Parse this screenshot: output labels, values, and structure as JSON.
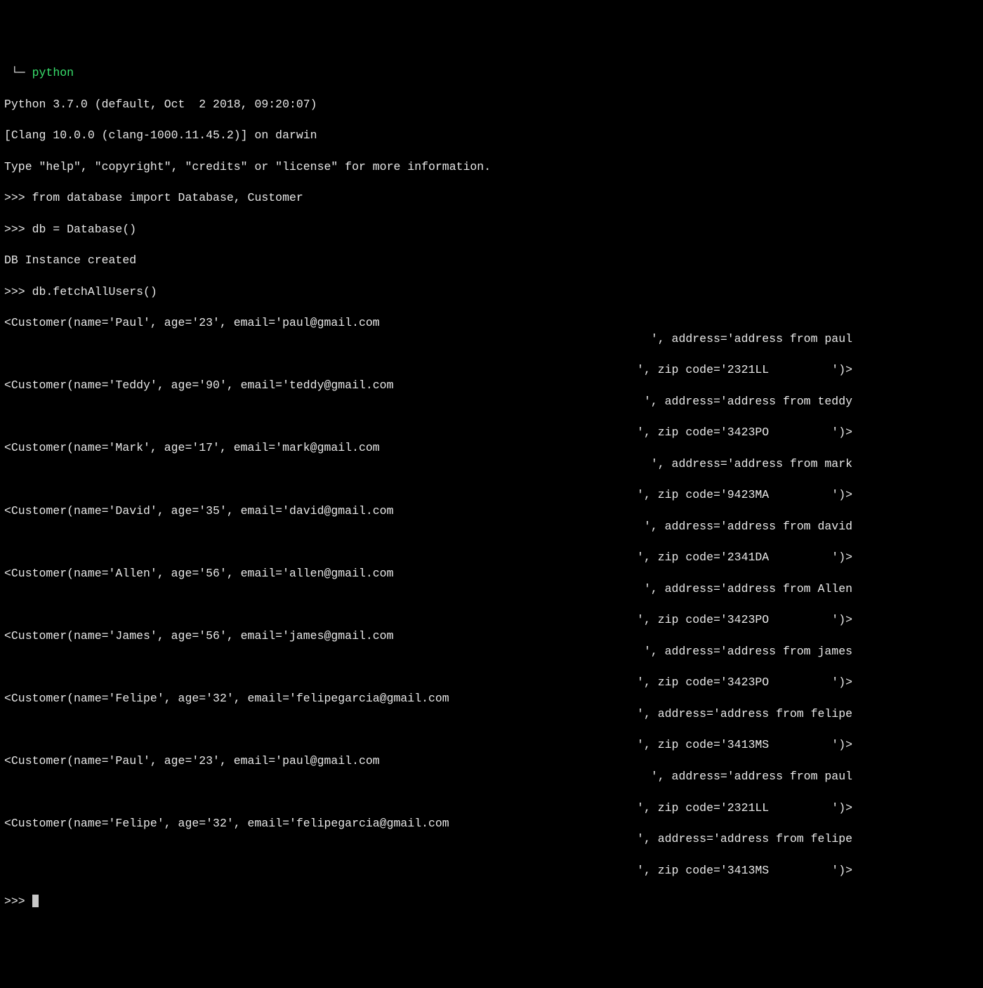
{
  "title_prefix": " └─ ",
  "title_cmd": "python",
  "lines": {
    "version": "Python 3.7.0 (default, Oct  2 2018, 09:20:07)",
    "clang": "[Clang 10.0.0 (clang-1000.11.45.2)] on darwin",
    "help": "Type \"help\", \"copyright\", \"credits\" or \"license\" for more information.",
    "import": ">>> from database import Database, Customer",
    "dbinit": ">>> db = Database()",
    "created": "DB Instance created",
    "fetch": ">>> db.fetchAllUsers()"
  },
  "customers": [
    {
      "name": "Paul",
      "age": "23",
      "email": "paul@gmail.com",
      "address": "address from paul",
      "zip": "2321LL"
    },
    {
      "name": "Teddy",
      "age": "90",
      "email": "teddy@gmail.com",
      "address": "address from teddy",
      "zip": "3423PO"
    },
    {
      "name": "Mark",
      "age": "17",
      "email": "mark@gmail.com",
      "address": "address from mark",
      "zip": "9423MA"
    },
    {
      "name": "David",
      "age": "35",
      "email": "david@gmail.com",
      "address": "address from david",
      "zip": "2341DA"
    },
    {
      "name": "Allen",
      "age": "56",
      "email": "allen@gmail.com",
      "address": "address from Allen",
      "zip": "3423PO"
    },
    {
      "name": "James",
      "age": "56",
      "email": "james@gmail.com",
      "address": "address from james",
      "zip": "3423PO"
    },
    {
      "name": "Felipe",
      "age": "32",
      "email": "felipegarcia@gmail.com",
      "address": "address from felipe",
      "zip": "3413MS"
    },
    {
      "name": "Paul",
      "age": "23",
      "email": "paul@gmail.com",
      "address": "address from paul",
      "zip": "2321LL"
    },
    {
      "name": "Felipe",
      "age": "32",
      "email": "felipegarcia@gmail.com",
      "address": "address from felipe",
      "zip": "3413MS"
    }
  ],
  "prompt": ">>> "
}
